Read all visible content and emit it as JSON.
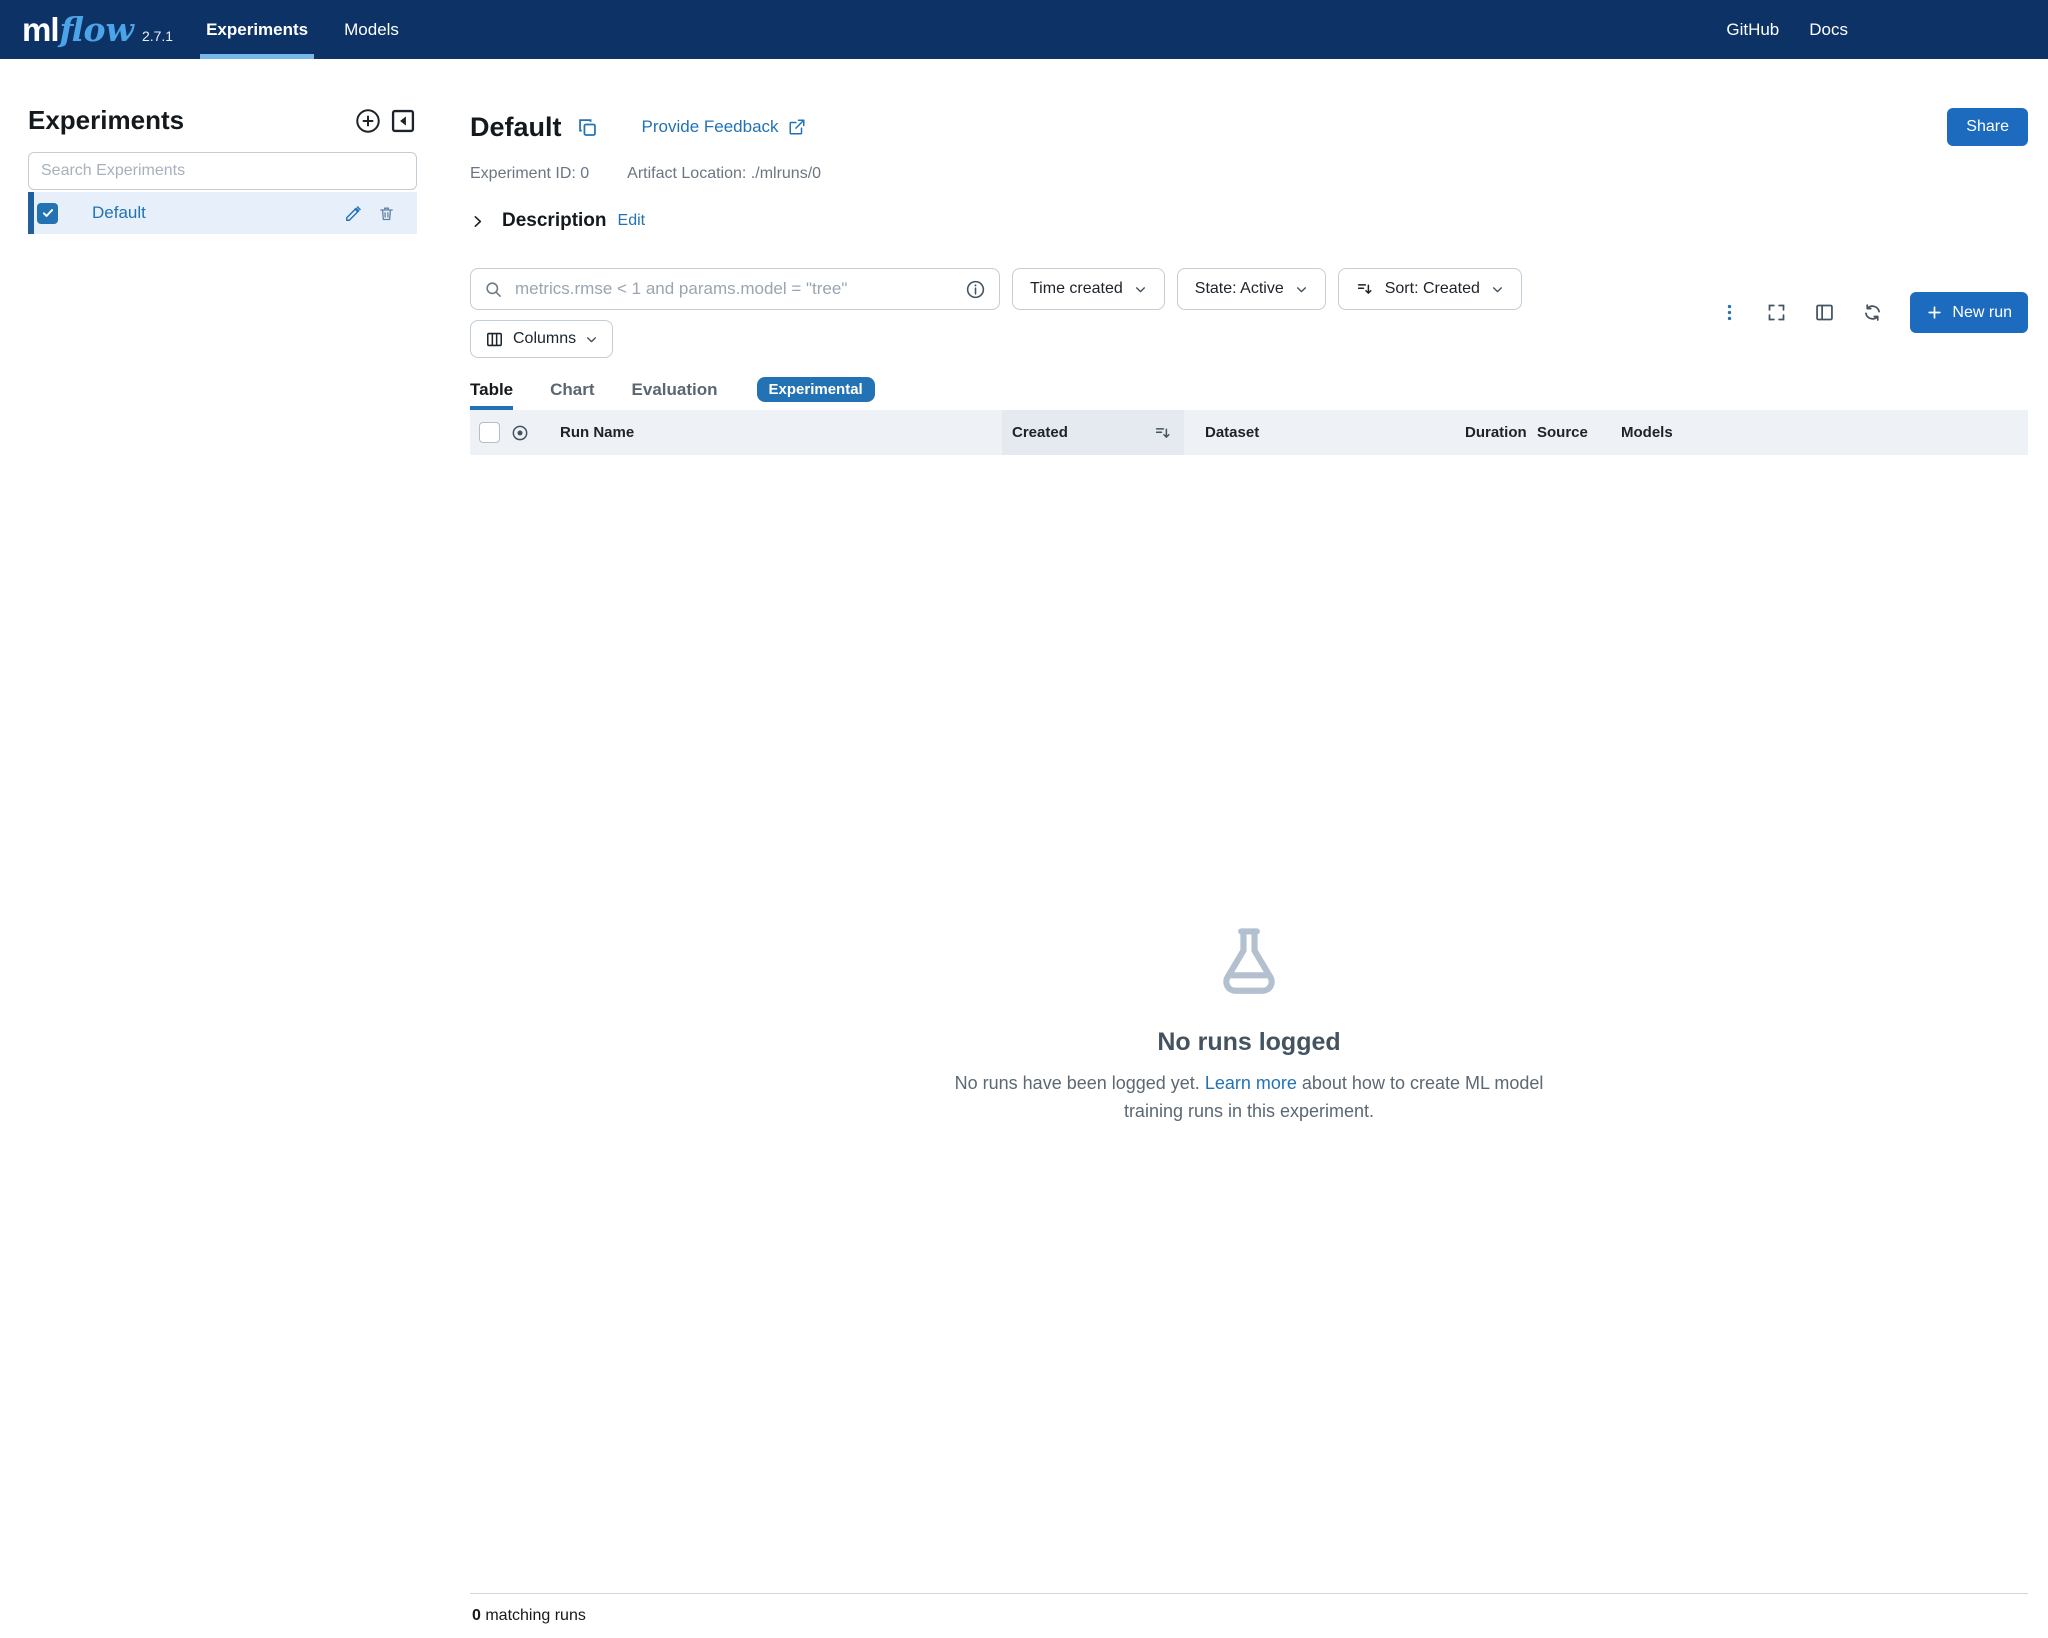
{
  "colors": {
    "navbar": "#0c3266",
    "accent": "#2272b4",
    "button": "#1d6bbf"
  },
  "navbar": {
    "logo_ml": "ml",
    "logo_flow": "flow",
    "version": "2.7.1",
    "tabs": [
      {
        "label": "Experiments",
        "active": true
      },
      {
        "label": "Models",
        "active": false
      }
    ],
    "links": [
      "GitHub",
      "Docs"
    ]
  },
  "sidebar": {
    "title": "Experiments",
    "search_placeholder": "Search Experiments",
    "items": [
      {
        "label": "Default",
        "selected": true
      }
    ]
  },
  "header": {
    "title": "Default",
    "feedback_link": "Provide Feedback",
    "share_button": "Share",
    "experiment_id_label": "Experiment ID:",
    "experiment_id": "0",
    "artifact_label": "Artifact Location:",
    "artifact_location": "./mlruns/0",
    "description_label": "Description",
    "edit_link": "Edit"
  },
  "controls": {
    "search_placeholder": "metrics.rmse < 1 and params.model = \"tree\"",
    "time_created_label": "Time created",
    "state_label": "State: Active",
    "sort_label": "Sort: Created",
    "columns_label": "Columns",
    "new_run_label": "New run"
  },
  "view_tabs": [
    {
      "label": "Table",
      "active": true
    },
    {
      "label": "Chart",
      "active": false
    },
    {
      "label": "Evaluation",
      "active": false
    }
  ],
  "experimental_badge": "Experimental",
  "table": {
    "columns": {
      "run_name": "Run Name",
      "created": "Created",
      "dataset": "Dataset",
      "duration": "Duration",
      "source": "Source",
      "models": "Models"
    }
  },
  "empty_state": {
    "title": "No runs logged",
    "text_before": "No runs have been logged yet. ",
    "link_text": "Learn more",
    "text_after": " about how to create ML model training runs in this experiment."
  },
  "footer": {
    "count": "0",
    "label": " matching runs"
  }
}
